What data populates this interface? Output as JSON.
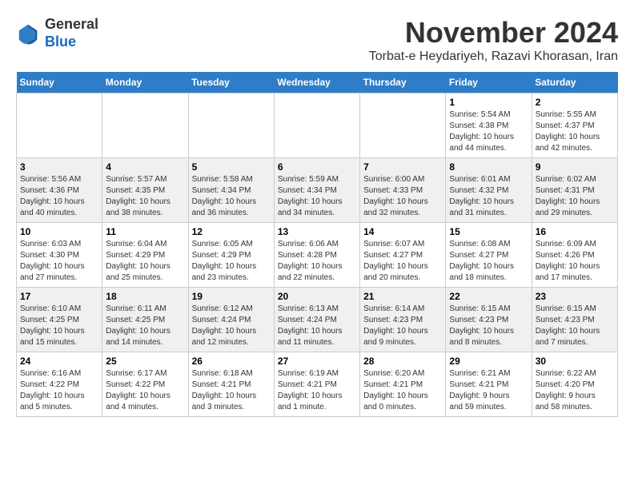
{
  "header": {
    "logo_line1": "General",
    "logo_line2": "Blue",
    "month": "November 2024",
    "location": "Torbat-e Heydariyeh, Razavi Khorasan, Iran"
  },
  "weekdays": [
    "Sunday",
    "Monday",
    "Tuesday",
    "Wednesday",
    "Thursday",
    "Friday",
    "Saturday"
  ],
  "weeks": [
    [
      {
        "day": "",
        "info": ""
      },
      {
        "day": "",
        "info": ""
      },
      {
        "day": "",
        "info": ""
      },
      {
        "day": "",
        "info": ""
      },
      {
        "day": "",
        "info": ""
      },
      {
        "day": "1",
        "info": "Sunrise: 5:54 AM\nSunset: 4:38 PM\nDaylight: 10 hours\nand 44 minutes."
      },
      {
        "day": "2",
        "info": "Sunrise: 5:55 AM\nSunset: 4:37 PM\nDaylight: 10 hours\nand 42 minutes."
      }
    ],
    [
      {
        "day": "3",
        "info": "Sunrise: 5:56 AM\nSunset: 4:36 PM\nDaylight: 10 hours\nand 40 minutes."
      },
      {
        "day": "4",
        "info": "Sunrise: 5:57 AM\nSunset: 4:35 PM\nDaylight: 10 hours\nand 38 minutes."
      },
      {
        "day": "5",
        "info": "Sunrise: 5:58 AM\nSunset: 4:34 PM\nDaylight: 10 hours\nand 36 minutes."
      },
      {
        "day": "6",
        "info": "Sunrise: 5:59 AM\nSunset: 4:34 PM\nDaylight: 10 hours\nand 34 minutes."
      },
      {
        "day": "7",
        "info": "Sunrise: 6:00 AM\nSunset: 4:33 PM\nDaylight: 10 hours\nand 32 minutes."
      },
      {
        "day": "8",
        "info": "Sunrise: 6:01 AM\nSunset: 4:32 PM\nDaylight: 10 hours\nand 31 minutes."
      },
      {
        "day": "9",
        "info": "Sunrise: 6:02 AM\nSunset: 4:31 PM\nDaylight: 10 hours\nand 29 minutes."
      }
    ],
    [
      {
        "day": "10",
        "info": "Sunrise: 6:03 AM\nSunset: 4:30 PM\nDaylight: 10 hours\nand 27 minutes."
      },
      {
        "day": "11",
        "info": "Sunrise: 6:04 AM\nSunset: 4:29 PM\nDaylight: 10 hours\nand 25 minutes."
      },
      {
        "day": "12",
        "info": "Sunrise: 6:05 AM\nSunset: 4:29 PM\nDaylight: 10 hours\nand 23 minutes."
      },
      {
        "day": "13",
        "info": "Sunrise: 6:06 AM\nSunset: 4:28 PM\nDaylight: 10 hours\nand 22 minutes."
      },
      {
        "day": "14",
        "info": "Sunrise: 6:07 AM\nSunset: 4:27 PM\nDaylight: 10 hours\nand 20 minutes."
      },
      {
        "day": "15",
        "info": "Sunrise: 6:08 AM\nSunset: 4:27 PM\nDaylight: 10 hours\nand 18 minutes."
      },
      {
        "day": "16",
        "info": "Sunrise: 6:09 AM\nSunset: 4:26 PM\nDaylight: 10 hours\nand 17 minutes."
      }
    ],
    [
      {
        "day": "17",
        "info": "Sunrise: 6:10 AM\nSunset: 4:25 PM\nDaylight: 10 hours\nand 15 minutes."
      },
      {
        "day": "18",
        "info": "Sunrise: 6:11 AM\nSunset: 4:25 PM\nDaylight: 10 hours\nand 14 minutes."
      },
      {
        "day": "19",
        "info": "Sunrise: 6:12 AM\nSunset: 4:24 PM\nDaylight: 10 hours\nand 12 minutes."
      },
      {
        "day": "20",
        "info": "Sunrise: 6:13 AM\nSunset: 4:24 PM\nDaylight: 10 hours\nand 11 minutes."
      },
      {
        "day": "21",
        "info": "Sunrise: 6:14 AM\nSunset: 4:23 PM\nDaylight: 10 hours\nand 9 minutes."
      },
      {
        "day": "22",
        "info": "Sunrise: 6:15 AM\nSunset: 4:23 PM\nDaylight: 10 hours\nand 8 minutes."
      },
      {
        "day": "23",
        "info": "Sunrise: 6:15 AM\nSunset: 4:23 PM\nDaylight: 10 hours\nand 7 minutes."
      }
    ],
    [
      {
        "day": "24",
        "info": "Sunrise: 6:16 AM\nSunset: 4:22 PM\nDaylight: 10 hours\nand 5 minutes."
      },
      {
        "day": "25",
        "info": "Sunrise: 6:17 AM\nSunset: 4:22 PM\nDaylight: 10 hours\nand 4 minutes."
      },
      {
        "day": "26",
        "info": "Sunrise: 6:18 AM\nSunset: 4:21 PM\nDaylight: 10 hours\nand 3 minutes."
      },
      {
        "day": "27",
        "info": "Sunrise: 6:19 AM\nSunset: 4:21 PM\nDaylight: 10 hours\nand 1 minute."
      },
      {
        "day": "28",
        "info": "Sunrise: 6:20 AM\nSunset: 4:21 PM\nDaylight: 10 hours\nand 0 minutes."
      },
      {
        "day": "29",
        "info": "Sunrise: 6:21 AM\nSunset: 4:21 PM\nDaylight: 9 hours\nand 59 minutes."
      },
      {
        "day": "30",
        "info": "Sunrise: 6:22 AM\nSunset: 4:20 PM\nDaylight: 9 hours\nand 58 minutes."
      }
    ]
  ]
}
